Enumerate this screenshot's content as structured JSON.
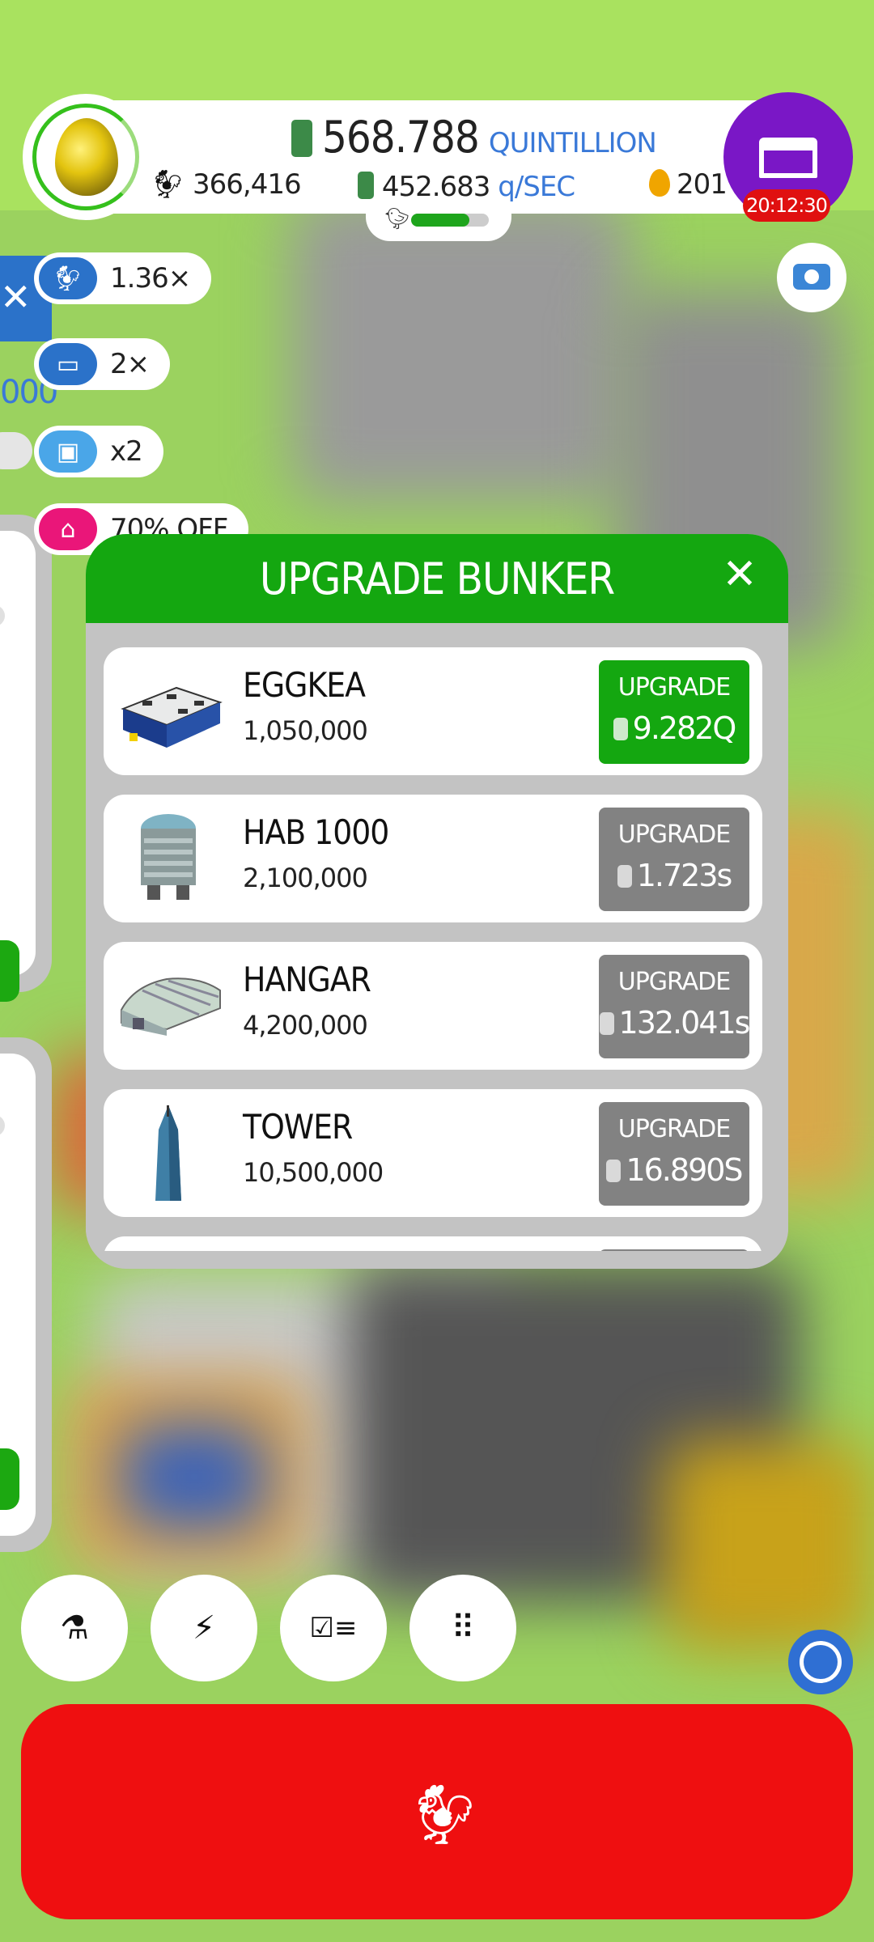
{
  "hud": {
    "money_value": "568.788",
    "money_unit": "QUINTILLION",
    "chickens": "366,416",
    "rate_value": "452.683",
    "rate_unit": "q/SEC",
    "golden_eggs": "201",
    "shop_timer": "20:12:30",
    "egg_progress_fraction": 0.75,
    "hab_progress_fraction": 0.75
  },
  "boosts": [
    {
      "icon": "chicken-icon",
      "label": "1.36×"
    },
    {
      "icon": "tv-icon",
      "label": "2×"
    },
    {
      "icon": "video-icon",
      "label": "x2"
    },
    {
      "icon": "house-icon",
      "label": "70% OFF"
    }
  ],
  "left_panel": {
    "number": "000"
  },
  "modal": {
    "title": "UPGRADE BUNKER",
    "rows": [
      {
        "name": "EGGKEA",
        "capacity": "1,050,000",
        "button_label": "UPGRADE",
        "cost": "9.282Q",
        "active": true
      },
      {
        "name": "HAB 1000",
        "capacity": "2,100,000",
        "button_label": "UPGRADE",
        "cost": "1.723s",
        "active": false
      },
      {
        "name": "HANGAR",
        "capacity": "4,200,000",
        "button_label": "UPGRADE",
        "cost": "132.041s",
        "active": false
      },
      {
        "name": "TOWER",
        "capacity": "10,500,000",
        "button_label": "UPGRADE",
        "cost": "16.890S",
        "active": false
      }
    ]
  },
  "toolbar": [
    "flask-icon",
    "lightning-icon",
    "checklist-icon",
    "grid-icon"
  ],
  "colors": {
    "green": "#14a710",
    "grey": "#828282",
    "red": "#ef0f10",
    "purple": "#7a17c6",
    "blue": "#2b72c9"
  }
}
